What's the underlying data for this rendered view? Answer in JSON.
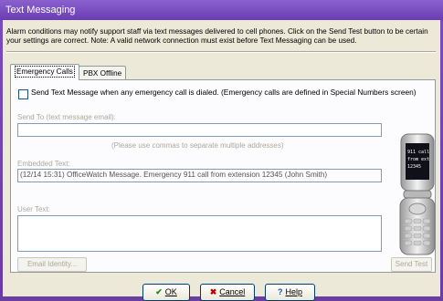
{
  "window": {
    "title": "Text Messaging"
  },
  "description": "Alarm conditions may notify support staff via text messages delivered to cell phones.  Click on the Send Test button to be certain your settings are correct. Note: A valid network connection must exist before Text Messaging can be used.",
  "tabs": [
    {
      "label": "Emergency Calls",
      "active": true
    },
    {
      "label": "PBX Offline",
      "active": false
    }
  ],
  "emergency": {
    "checkbox_label": "Send Text Message when any emergency call is dialed.  (Emergency calls are defined in Special Numbers screen)",
    "checkbox_checked": false,
    "send_to_label": "Send To (text message email):",
    "send_to_value": "",
    "send_to_hint": "(Please use commas to separate multiple addresses)",
    "embedded_label": "Embedded Text:",
    "embedded_value": "(12/14 15:31) OfficeWatch Message. Emergency 911 call from extension 12345 (John Smith)",
    "user_text_label": "User Text:",
    "user_text_value": "",
    "email_identity_button": "Email Identity...",
    "send_test_button": "Send Test",
    "phone_screen_lines": [
      "911 call",
      "from ext",
      "12345"
    ]
  },
  "buttons": {
    "ok": "OK",
    "cancel": "Cancel",
    "help": "Help"
  },
  "icons": {
    "ok": "check-icon",
    "cancel": "x-icon",
    "help": "question-icon"
  },
  "colors": {
    "title_bar": "#6b3db0",
    "dialog_bg": "#ece9d8",
    "ok_check": "#1a8a1a",
    "cancel_x": "#c00000",
    "help_q": "#1c4fa8"
  }
}
